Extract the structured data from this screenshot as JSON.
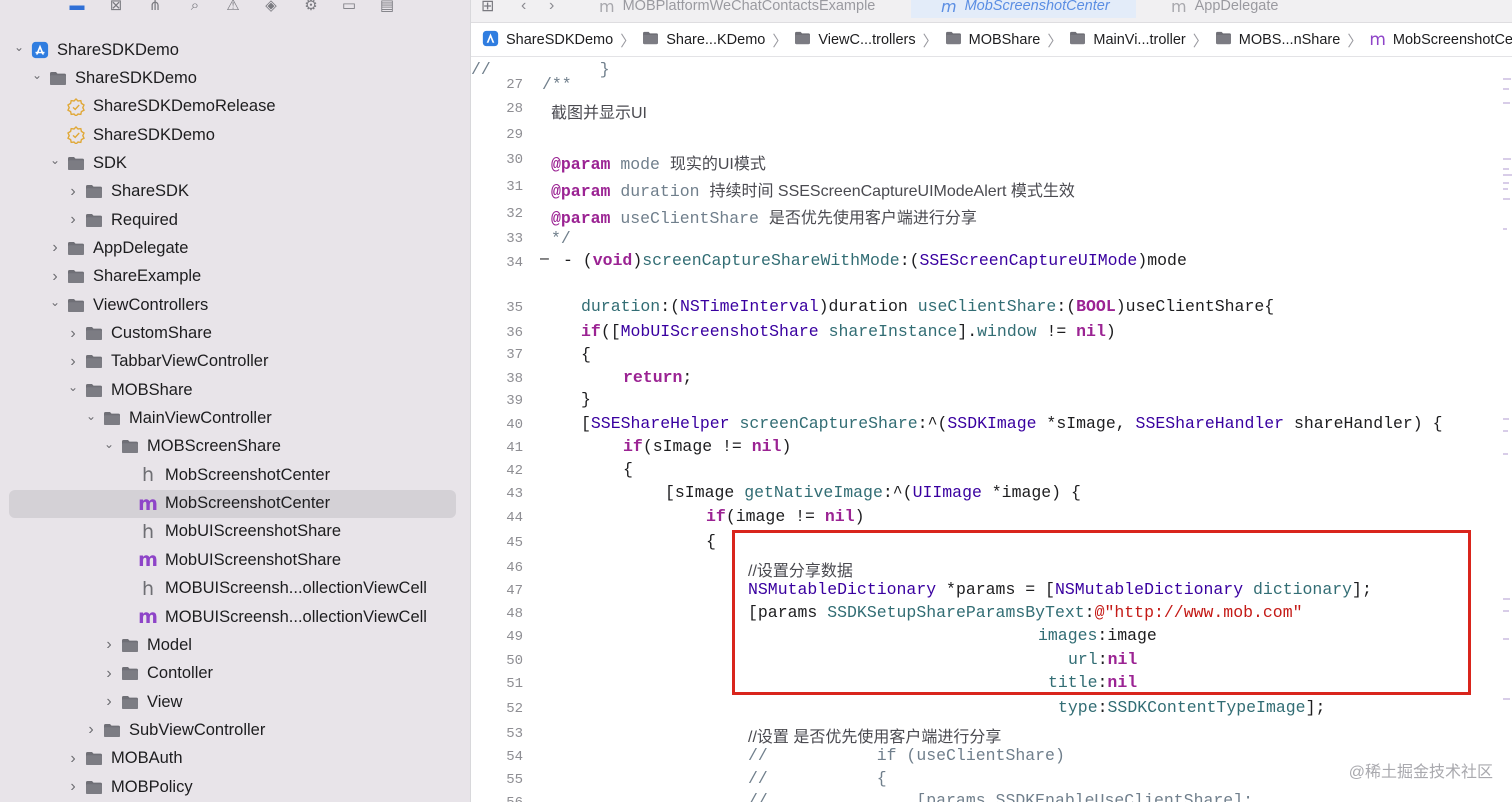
{
  "navigator": {
    "toolbar_icons": [
      "folder-icon",
      "source-control-icon",
      "hierarchy-icon",
      "search-icon",
      "warning-icon",
      "test-icon",
      "debug-icon",
      "breakpoint-icon",
      "report-icon"
    ],
    "items": [
      {
        "label": "ShareSDKDemo",
        "type": "project",
        "indent": 0,
        "expanded": true
      },
      {
        "label": "ShareSDKDemo",
        "type": "folder",
        "indent": 1,
        "expanded": true
      },
      {
        "label": "ShareSDKDemoRelease",
        "type": "entitlement",
        "indent": 2
      },
      {
        "label": "ShareSDKDemo",
        "type": "entitlement",
        "indent": 2
      },
      {
        "label": "SDK",
        "type": "folder",
        "indent": 2,
        "expanded": true
      },
      {
        "label": "ShareSDK",
        "type": "folder",
        "indent": 3,
        "expanded": false
      },
      {
        "label": "Required",
        "type": "folder",
        "indent": 3,
        "expanded": false
      },
      {
        "label": "AppDelegate",
        "type": "folder",
        "indent": 2,
        "expanded": false
      },
      {
        "label": "ShareExample",
        "type": "folder",
        "indent": 2,
        "expanded": false
      },
      {
        "label": "ViewControllers",
        "type": "folder",
        "indent": 2,
        "expanded": true
      },
      {
        "label": "CustomShare",
        "type": "folder",
        "indent": 3,
        "expanded": false
      },
      {
        "label": "TabbarViewController",
        "type": "folder",
        "indent": 3,
        "expanded": false
      },
      {
        "label": "MOBShare",
        "type": "folder",
        "indent": 3,
        "expanded": true
      },
      {
        "label": "MainViewController",
        "type": "folder",
        "indent": 4,
        "expanded": true
      },
      {
        "label": "MOBScreenShare",
        "type": "folder",
        "indent": 5,
        "expanded": true
      },
      {
        "label": "MobScreenshotCenter",
        "type": "h",
        "indent": 6
      },
      {
        "label": "MobScreenshotCenter",
        "type": "m",
        "indent": 6,
        "selected": true
      },
      {
        "label": "MobUIScreenshotShare",
        "type": "h",
        "indent": 6
      },
      {
        "label": "MobUIScreenshotShare",
        "type": "m",
        "indent": 6
      },
      {
        "label": "MOBUIScreensh...ollectionViewCell",
        "type": "h",
        "indent": 6
      },
      {
        "label": "MOBUIScreensh...ollectionViewCell",
        "type": "m",
        "indent": 6
      },
      {
        "label": "Model",
        "type": "folder",
        "indent": 5,
        "expanded": false
      },
      {
        "label": "Contoller",
        "type": "folder",
        "indent": 5,
        "expanded": false
      },
      {
        "label": "View",
        "type": "folder",
        "indent": 5,
        "expanded": false
      },
      {
        "label": "SubViewController",
        "type": "folder",
        "indent": 4,
        "expanded": false
      },
      {
        "label": "MOBAuth",
        "type": "folder",
        "indent": 3,
        "expanded": false
      },
      {
        "label": "MOBPolicy",
        "type": "folder",
        "indent": 3,
        "expanded": false
      }
    ]
  },
  "tabs": [
    {
      "label": "MOBPlatformWeChatContactsExample",
      "active": false
    },
    {
      "label": "MobScreenshotCenter",
      "active": true
    },
    {
      "label": "AppDelegate",
      "active": false
    }
  ],
  "breadcrumbs": [
    {
      "label": "ShareSDKDemo",
      "icon": "project-icon"
    },
    {
      "label": "Share...KDemo",
      "icon": "folder-icon"
    },
    {
      "label": "ViewC...trollers",
      "icon": "folder-icon"
    },
    {
      "label": "MOBShare",
      "icon": "folder-icon"
    },
    {
      "label": "MainVi...troller",
      "icon": "folder-icon"
    },
    {
      "label": "MOBS...nShare",
      "icon": "folder-icon"
    },
    {
      "label": "MobScreenshotCenter",
      "icon": "m-file-icon"
    },
    {
      "label": "N",
      "icon": ""
    }
  ],
  "code": {
    "line_numbers": [
      "27",
      "28",
      "29",
      "30",
      "31",
      "32",
      "33",
      "34",
      "35",
      "36",
      "37",
      "38",
      "39",
      "40",
      "41",
      "42",
      "43",
      "44",
      "45",
      "46",
      "47",
      "48",
      "49",
      "50",
      "51",
      "52",
      "53",
      "54",
      "55",
      "56"
    ],
    "lines": [
      [
        {
          "t": "/**",
          "c": "cm"
        }
      ],
      [
        {
          "t": "截图并显示UI",
          "c": "cmz"
        }
      ],
      [],
      [
        {
          "t": "@param",
          "c": "kw"
        },
        {
          "t": " mode ",
          "c": "cm"
        },
        {
          "t": "现实的UI模式",
          "c": "cmz"
        }
      ],
      [
        {
          "t": "@param",
          "c": "kw"
        },
        {
          "t": " duration ",
          "c": "cm"
        },
        {
          "t": "持续时间 SSEScreenCaptureUIModeAlert 模式生效",
          "c": "cmz"
        }
      ],
      [
        {
          "t": "@param",
          "c": "kw"
        },
        {
          "t": " useClientShare ",
          "c": "cm"
        },
        {
          "t": "是否优先使用客户端进行分享",
          "c": "cmz"
        }
      ],
      [
        {
          "t": "*/",
          "c": "cm"
        }
      ],
      [
        {
          "t": "- (",
          "c": ""
        },
        {
          "t": "void",
          "c": "kw"
        },
        {
          "t": ")",
          "c": ""
        },
        {
          "t": "screenCaptureShareWithMode",
          "c": "fn"
        },
        {
          "t": ":(",
          "c": ""
        },
        {
          "t": "SSEScreenCaptureUIMode",
          "c": "ty"
        },
        {
          "t": ")mode",
          "c": ""
        }
      ],
      [
        {
          "t": "duration",
          "c": "fn"
        },
        {
          "t": ":(",
          "c": ""
        },
        {
          "t": "NSTimeInterval",
          "c": "ty"
        },
        {
          "t": ")duration ",
          "c": ""
        },
        {
          "t": "useClientShare",
          "c": "fn"
        },
        {
          "t": ":(",
          "c": ""
        },
        {
          "t": "BOOL",
          "c": "kw"
        },
        {
          "t": ")useClientShare{",
          "c": ""
        }
      ],
      [
        {
          "t": "if",
          "c": "kw"
        },
        {
          "t": "([",
          "c": ""
        },
        {
          "t": "MobUIScreenshotShare",
          "c": "ty"
        },
        {
          "t": " ",
          "c": ""
        },
        {
          "t": "shareInstance",
          "c": "fn"
        },
        {
          "t": "].",
          "c": ""
        },
        {
          "t": "window",
          "c": "fn"
        },
        {
          "t": " != ",
          "c": ""
        },
        {
          "t": "nil",
          "c": "nil"
        },
        {
          "t": ")",
          "c": ""
        }
      ],
      [
        {
          "t": "{",
          "c": ""
        }
      ],
      [
        {
          "t": "return",
          "c": "kw"
        },
        {
          "t": ";",
          "c": ""
        }
      ],
      [
        {
          "t": "}",
          "c": ""
        }
      ],
      [
        {
          "t": "[",
          "c": ""
        },
        {
          "t": "SSEShareHelper",
          "c": "ty"
        },
        {
          "t": " ",
          "c": ""
        },
        {
          "t": "screenCaptureShare",
          "c": "fn"
        },
        {
          "t": ":^(",
          "c": ""
        },
        {
          "t": "SSDKImage",
          "c": "ty"
        },
        {
          "t": " *sImage, ",
          "c": ""
        },
        {
          "t": "SSEShareHandler",
          "c": "ty"
        },
        {
          "t": " shareHandler) {",
          "c": ""
        }
      ],
      [
        {
          "t": "if",
          "c": "kw"
        },
        {
          "t": "(sImage != ",
          "c": ""
        },
        {
          "t": "nil",
          "c": "nil"
        },
        {
          "t": ")",
          "c": ""
        }
      ],
      [
        {
          "t": "{",
          "c": ""
        }
      ],
      [
        {
          "t": "[sImage ",
          "c": ""
        },
        {
          "t": "getNativeImage",
          "c": "fn"
        },
        {
          "t": ":^(",
          "c": ""
        },
        {
          "t": "UIImage",
          "c": "ty"
        },
        {
          "t": " *image) {",
          "c": ""
        }
      ],
      [
        {
          "t": "if",
          "c": "kw"
        },
        {
          "t": "(image != ",
          "c": ""
        },
        {
          "t": "nil",
          "c": "nil"
        },
        {
          "t": ")",
          "c": ""
        }
      ],
      [
        {
          "t": "{",
          "c": ""
        }
      ],
      [
        {
          "t": "//设置分享数据",
          "c": "cmz"
        }
      ],
      [
        {
          "t": "NSMutableDictionary",
          "c": "ty"
        },
        {
          "t": " *params = [",
          "c": ""
        },
        {
          "t": "NSMutableDictionary",
          "c": "ty"
        },
        {
          "t": " ",
          "c": ""
        },
        {
          "t": "dictionary",
          "c": "fn"
        },
        {
          "t": "];",
          "c": ""
        }
      ],
      [
        {
          "t": "[params ",
          "c": ""
        },
        {
          "t": "SSDKSetupShareParamsByText",
          "c": "fn"
        },
        {
          "t": ":",
          "c": ""
        },
        {
          "t": "@\"http://www.mob.com\"",
          "c": "st"
        }
      ],
      [
        {
          "t": "images",
          "c": "fn"
        },
        {
          "t": ":image",
          "c": ""
        }
      ],
      [
        {
          "t": "url",
          "c": "fn"
        },
        {
          "t": ":",
          "c": ""
        },
        {
          "t": "nil",
          "c": "nil"
        }
      ],
      [
        {
          "t": "title",
          "c": "fn"
        },
        {
          "t": ":",
          "c": ""
        },
        {
          "t": "nil",
          "c": "nil"
        }
      ],
      [
        {
          "t": "type",
          "c": "fn"
        },
        {
          "t": ":",
          "c": ""
        },
        {
          "t": "SSDKContentTypeImage",
          "c": "fn"
        },
        {
          "t": "];",
          "c": ""
        }
      ],
      [
        {
          "t": "//设置 是否优先使用客户端进行分享",
          "c": "cmz"
        }
      ],
      [
        {
          "t": "//           if (useClientShare)",
          "c": "cm"
        }
      ],
      [
        {
          "t": "//           {",
          "c": "cm"
        }
      ],
      [
        {
          "t": "//               [params SSDKEnableUseClientShare];",
          "c": "cm"
        }
      ],
      [
        {
          "t": "//           }",
          "c": "cm"
        }
      ]
    ]
  },
  "watermark": "@稀土掘金技术社区",
  "colors": {
    "highlight_box": "#d9251c",
    "keyword": "#9b2393",
    "type": "#3900a0",
    "function": "#326d74",
    "comment": "#707f8c",
    "string": "#c41a16"
  }
}
